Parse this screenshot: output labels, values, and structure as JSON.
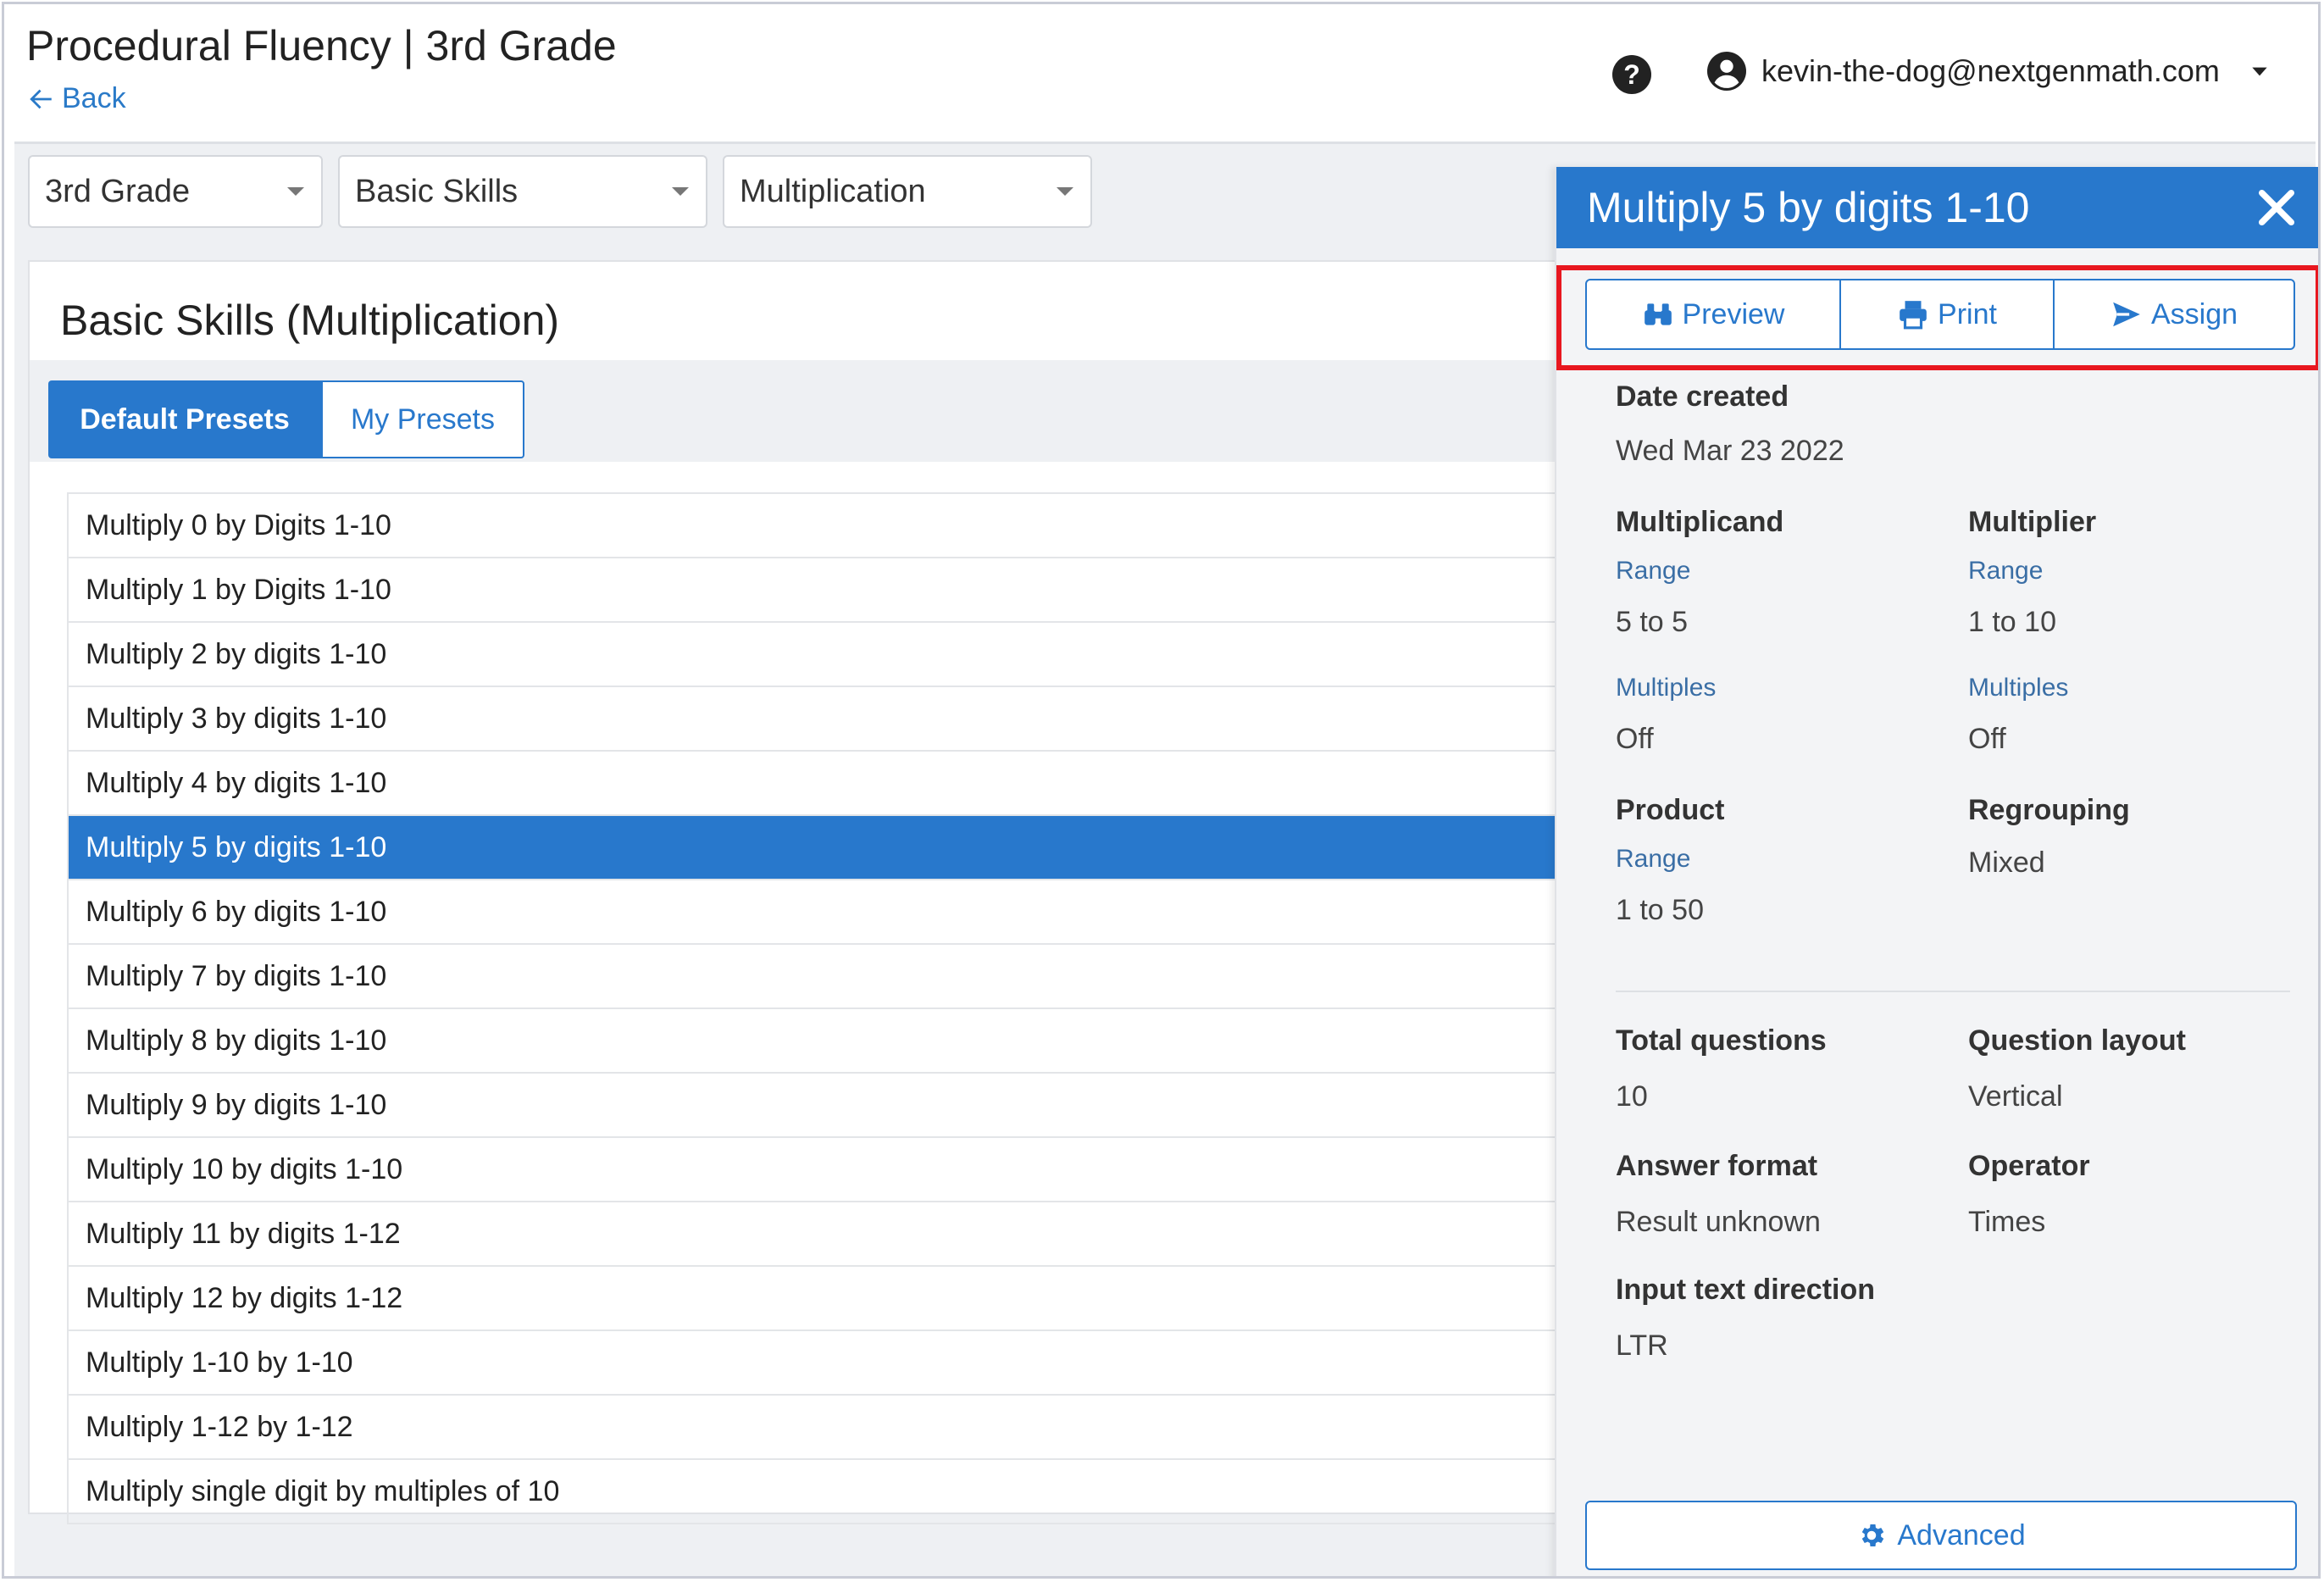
{
  "header": {
    "title": "Procedural Fluency | 3rd Grade",
    "back_label": "Back",
    "user_email": "kevin-the-dog@nextgenmath.com"
  },
  "filters": {
    "grade": "3rd Grade",
    "category": "Basic Skills",
    "topic": "Multiplication"
  },
  "card": {
    "title": "Basic Skills (Multiplication)",
    "tabs": [
      "Default Presets",
      "My Presets"
    ],
    "presets": [
      "Multiply 0 by Digits 1-10",
      "Multiply 1 by Digits 1-10",
      "Multiply 2 by digits 1-10",
      "Multiply 3 by digits 1-10",
      "Multiply 4 by digits 1-10",
      "Multiply 5 by digits 1-10",
      "Multiply 6 by digits 1-10",
      "Multiply 7 by digits 1-10",
      "Multiply 8 by digits 1-10",
      "Multiply 9 by digits 1-10",
      "Multiply 10 by digits 1-10",
      "Multiply 11 by digits 1-12",
      "Multiply 12 by digits 1-12",
      "Multiply 1-10 by 1-10",
      "Multiply 1-12 by 1-12",
      "Multiply single digit by multiples of 10"
    ],
    "selected_index": 5
  },
  "panel": {
    "title": "Multiply 5 by digits 1-10",
    "actions": {
      "preview": "Preview",
      "print": "Print",
      "assign": "Assign"
    },
    "date_created_label": "Date created",
    "date_created": "Wed Mar 23 2022",
    "multiplicand": {
      "label": "Multiplicand",
      "range_label": "Range",
      "range": "5 to 5",
      "multiples_label": "Multiples",
      "multiples": "Off"
    },
    "multiplier": {
      "label": "Multiplier",
      "range_label": "Range",
      "range": "1 to 10",
      "multiples_label": "Multiples",
      "multiples": "Off"
    },
    "product": {
      "label": "Product",
      "range_label": "Range",
      "range": "1 to 50"
    },
    "regrouping": {
      "label": "Regrouping",
      "value": "Mixed"
    },
    "total_questions": {
      "label": "Total questions",
      "value": "10"
    },
    "question_layout": {
      "label": "Question layout",
      "value": "Vertical"
    },
    "answer_format": {
      "label": "Answer format",
      "value": "Result unknown"
    },
    "operator": {
      "label": "Operator",
      "value": "Times"
    },
    "input_direction": {
      "label": "Input text direction",
      "value": "LTR"
    },
    "advanced_label": "Advanced"
  },
  "colors": {
    "accent": "#2878cc",
    "highlight": "#e8171f"
  }
}
